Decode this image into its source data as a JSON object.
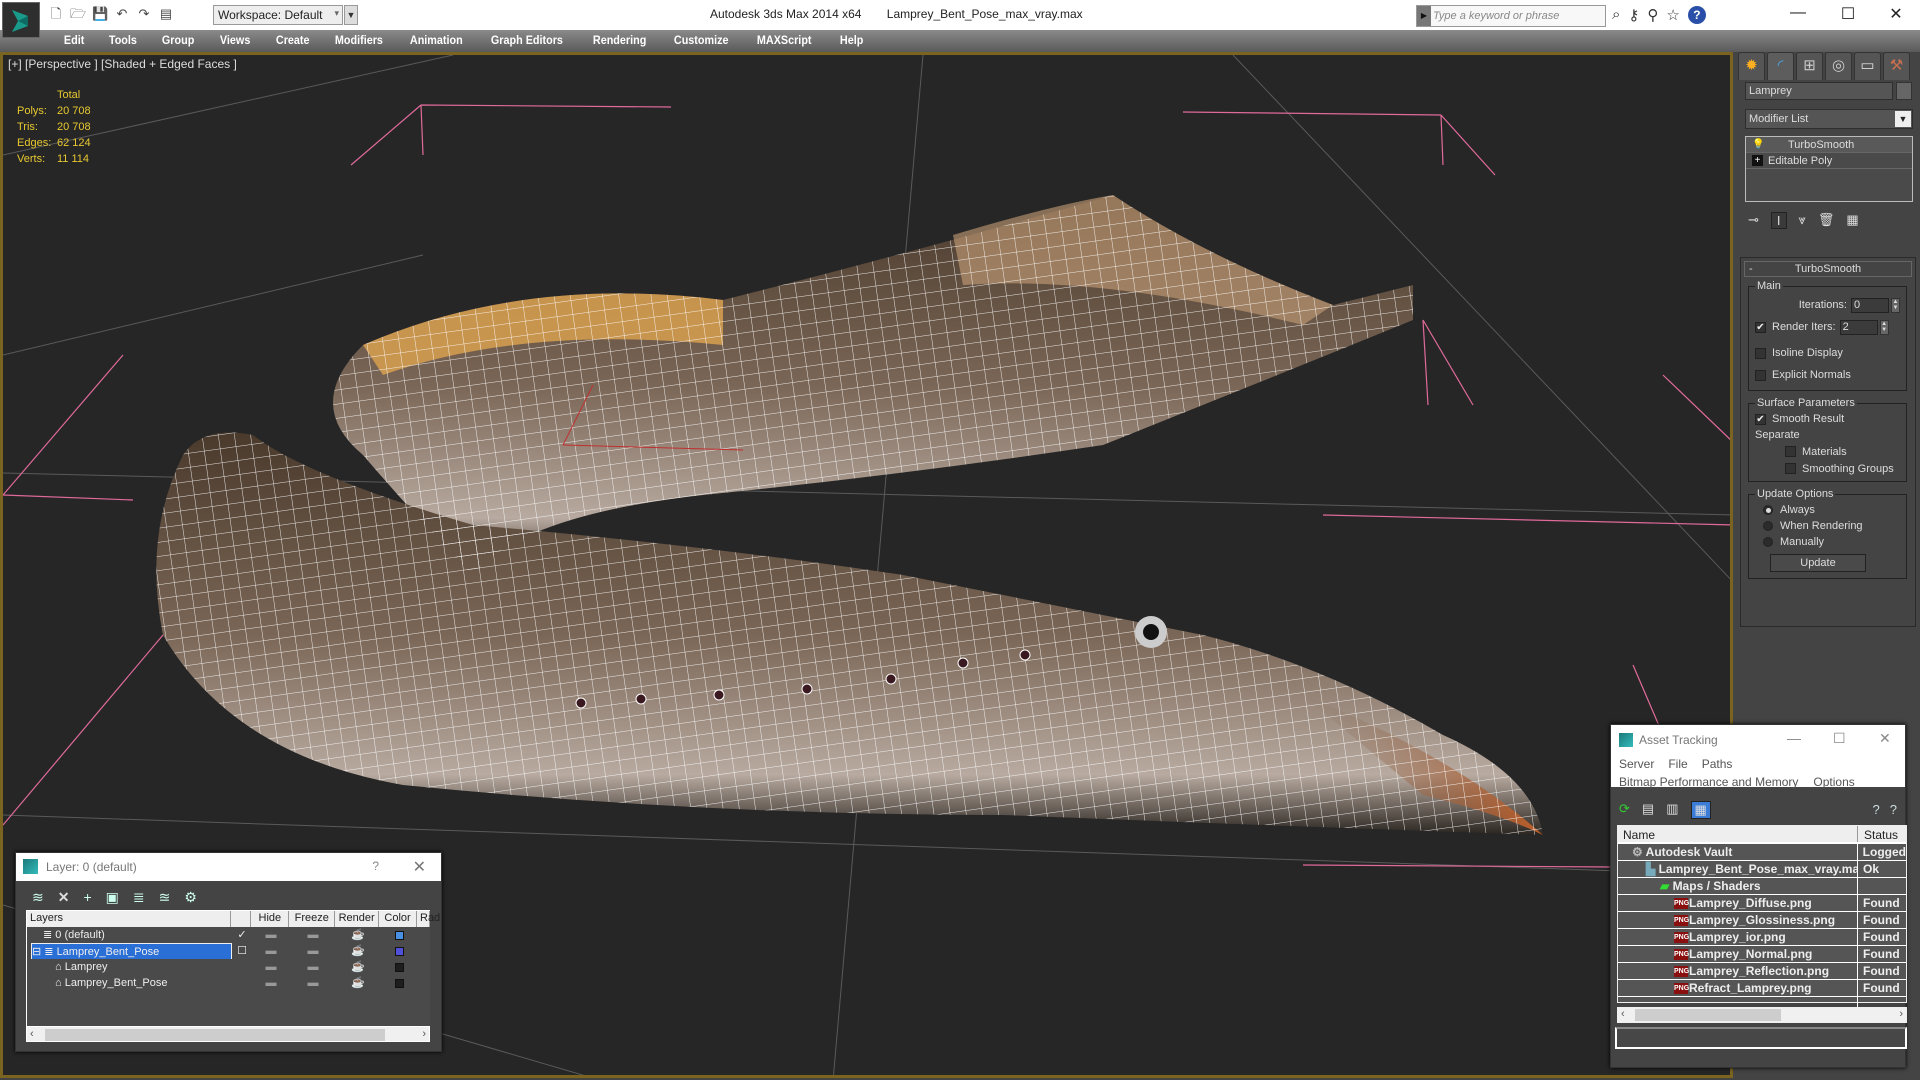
{
  "titlebar": {
    "app_title": "Autodesk 3ds Max  2014 x64",
    "file_name": "Lamprey_Bent_Pose_max_vray.max",
    "workspace_label": "Workspace: Default",
    "search_placeholder": "Type a keyword or phrase",
    "quick_access_icons": [
      "new-file-icon",
      "open-file-icon",
      "save-icon",
      "undo-icon",
      "redo-icon",
      "project-folder-icon"
    ],
    "toolbar_icons": [
      "binoculars-icon",
      "key-icon",
      "satellite-icon",
      "star-icon",
      "help-icon"
    ],
    "window_controls": {
      "minimize": "—",
      "maximize": "☐",
      "close": "✕"
    }
  },
  "menubar": {
    "items": [
      "Edit",
      "Tools",
      "Group",
      "Views",
      "Create",
      "Modifiers",
      "Animation",
      "Graph Editors",
      "Rendering",
      "Customize",
      "MAXScript",
      "Help"
    ]
  },
  "viewport": {
    "label": "[+] [Perspective ] [Shaded + Edged Faces ]",
    "stats": {
      "header": "Total",
      "rows": [
        {
          "label": "Polys:",
          "value": "20 708"
        },
        {
          "label": "Tris:",
          "value": "20 708"
        },
        {
          "label": "Edges:",
          "value": "62 124"
        },
        {
          "label": "Verts:",
          "value": "11 114"
        }
      ]
    },
    "border_color": "#7a6420",
    "stats_color": "#e8c830"
  },
  "command_panel": {
    "tabs": [
      "create-icon",
      "modify-icon",
      "hierarchy-icon",
      "motion-icon",
      "display-icon",
      "utilities-icon"
    ],
    "active_tab": 1,
    "object_name": "Lamprey",
    "modifier_list": "Modifier List",
    "stack": [
      {
        "label": "TurboSmooth",
        "selected": true
      },
      {
        "label": "Editable Poly",
        "selected": false
      }
    ],
    "turbosmooth": {
      "title": "TurboSmooth",
      "main_legend": "Main",
      "iterations_label": "Iterations:",
      "iterations_value": "0",
      "render_iters_label": "Render Iters:",
      "render_iters_value": "2",
      "render_iters_checked": true,
      "isoline_label": "Isoline Display",
      "isoline_checked": false,
      "explicit_normals_label": "Explicit Normals",
      "explicit_normals_checked": false,
      "surface_legend": "Surface Parameters",
      "smooth_result_label": "Smooth Result",
      "smooth_result_checked": true,
      "separate_label": "Separate",
      "materials_label": "Materials",
      "smoothing_groups_label": "Smoothing Groups",
      "update_legend": "Update Options",
      "update_options": [
        "Always",
        "When Rendering",
        "Manually"
      ],
      "update_selected": "Always",
      "update_button": "Update"
    }
  },
  "layer_panel": {
    "title": "Layer: 0 (default)",
    "help": "?",
    "close": "✕",
    "columns": [
      "Layers",
      "",
      "Hide",
      "Freeze",
      "Render",
      "Color",
      "Rad"
    ],
    "rows": [
      {
        "name": "0 (default)",
        "current": "✓",
        "color": "#4a90e2",
        "indent": 1,
        "type": "layer",
        "selected": false
      },
      {
        "name": "Lamprey_Bent_Pose",
        "current": "☐",
        "color": "#5050d8",
        "indent": 0,
        "type": "layer",
        "selected": true
      },
      {
        "name": "Lamprey",
        "current": "",
        "color": "#1e1e1e",
        "indent": 2,
        "type": "object",
        "selected": false
      },
      {
        "name": "Lamprey_Bent_Pose",
        "current": "",
        "color": "#1e1e1e",
        "indent": 2,
        "type": "object",
        "selected": false
      }
    ]
  },
  "asset_tracking": {
    "title": "Asset Tracking",
    "menu1": [
      "Server",
      "File",
      "Paths"
    ],
    "menu2": [
      "Bitmap Performance and Memory",
      "Options"
    ],
    "columns": {
      "name": "Name",
      "status": "Status"
    },
    "rows": [
      {
        "name": "Autodesk Vault",
        "status": "Logged",
        "indent": 1,
        "icon": "vault-icon"
      },
      {
        "name": "Lamprey_Bent_Pose_max_vray.max",
        "status": "Ok",
        "indent": 2,
        "icon": "max-file-icon"
      },
      {
        "name": "Maps / Shaders",
        "status": "",
        "indent": 3,
        "icon": "maps-icon"
      },
      {
        "name": "Lamprey_Diffuse.png",
        "status": "Found",
        "indent": 4,
        "icon": "png-icon"
      },
      {
        "name": "Lamprey_Glossiness.png",
        "status": "Found",
        "indent": 4,
        "icon": "png-icon"
      },
      {
        "name": "Lamprey_ior.png",
        "status": "Found",
        "indent": 4,
        "icon": "png-icon"
      },
      {
        "name": "Lamprey_Normal.png",
        "status": "Found",
        "indent": 4,
        "icon": "png-icon"
      },
      {
        "name": "Lamprey_Reflection.png",
        "status": "Found",
        "indent": 4,
        "icon": "png-icon"
      },
      {
        "name": "Refract_Lamprey.png",
        "status": "Found",
        "indent": 4,
        "icon": "png-icon"
      }
    ]
  }
}
